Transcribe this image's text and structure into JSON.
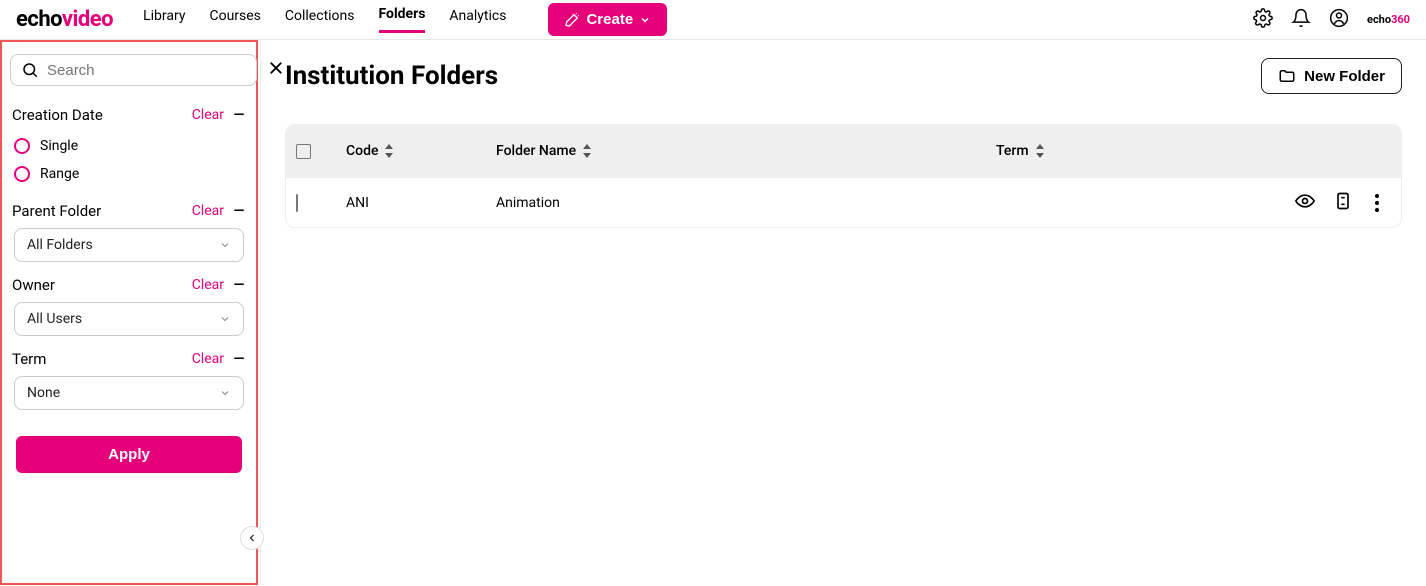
{
  "logo": {
    "part1": "echo",
    "part2": "video"
  },
  "nav": {
    "library": "Library",
    "courses": "Courses",
    "collections": "Collections",
    "folders": "Folders",
    "analytics": "Analytics"
  },
  "create_btn": "Create",
  "brand_small": {
    "part1": "echo",
    "part2": "360"
  },
  "sidebar": {
    "search_placeholder": "Search",
    "filters": {
      "creation_date": {
        "label": "Creation Date",
        "clear": "Clear",
        "opt_single": "Single",
        "opt_range": "Range"
      },
      "parent_folder": {
        "label": "Parent Folder",
        "clear": "Clear",
        "value": "All Folders"
      },
      "owner": {
        "label": "Owner",
        "clear": "Clear",
        "value": "All Users"
      },
      "term": {
        "label": "Term",
        "clear": "Clear",
        "value": "None"
      }
    },
    "apply": "Apply"
  },
  "page": {
    "title": "Institution Folders",
    "new_folder": "New Folder"
  },
  "table": {
    "headers": {
      "code": "Code",
      "folder_name": "Folder Name",
      "term": "Term"
    },
    "rows": [
      {
        "code": "ANI",
        "name": "Animation",
        "term": ""
      }
    ]
  }
}
